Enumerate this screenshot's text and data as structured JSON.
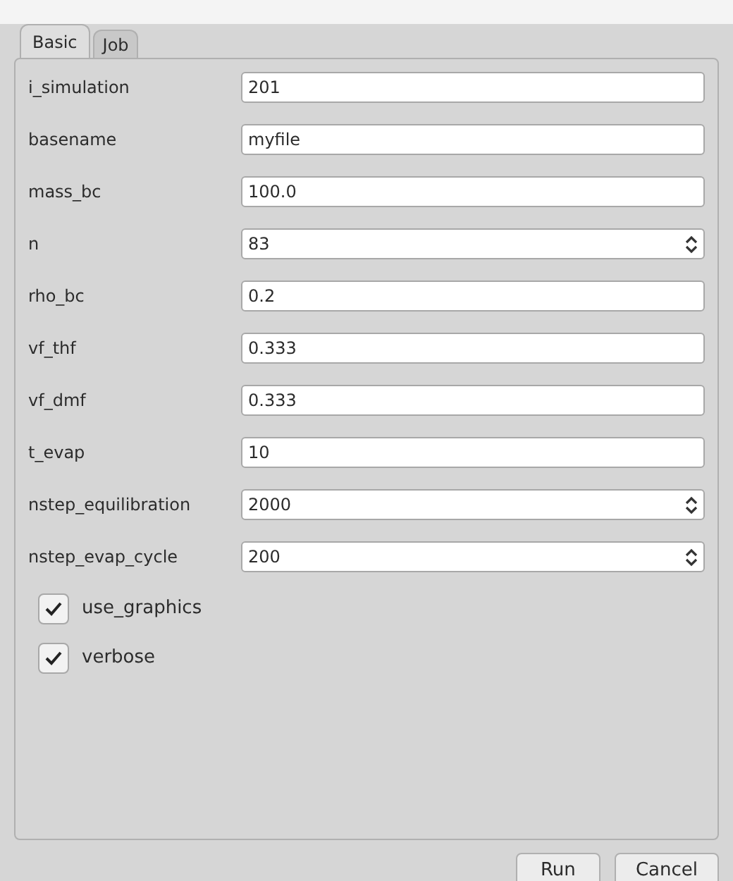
{
  "tabs": [
    {
      "label": "Basic",
      "selected": true
    },
    {
      "label": "Job",
      "selected": false
    }
  ],
  "fields": [
    {
      "label": "i_simulation",
      "value": "201",
      "kind": "text"
    },
    {
      "label": "basename",
      "value": "myfile",
      "kind": "text"
    },
    {
      "label": "mass_bc",
      "value": "100.0",
      "kind": "text"
    },
    {
      "label": "n",
      "value": "83",
      "kind": "spin"
    },
    {
      "label": "rho_bc",
      "value": "0.2",
      "kind": "text"
    },
    {
      "label": "vf_thf",
      "value": "0.333",
      "kind": "text"
    },
    {
      "label": "vf_dmf",
      "value": "0.333",
      "kind": "text"
    },
    {
      "label": "t_evap",
      "value": "10",
      "kind": "text"
    },
    {
      "label": "nstep_equilibration",
      "value": "2000",
      "kind": "spin"
    },
    {
      "label": "nstep_evap_cycle",
      "value": "200",
      "kind": "spin"
    }
  ],
  "checkboxes": [
    {
      "label": "use_graphics",
      "checked": true
    },
    {
      "label": "verbose",
      "checked": true
    }
  ],
  "buttons": [
    "Run",
    "Cancel"
  ]
}
